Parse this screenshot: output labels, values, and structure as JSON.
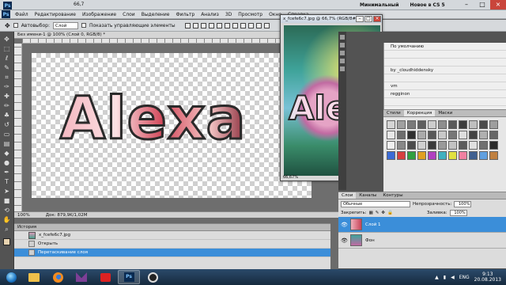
{
  "app": {
    "zoom_level": "66,7",
    "workspace_labels": [
      "Минимальный",
      "Новое в CS 5"
    ]
  },
  "menu": {
    "items": [
      "Файл",
      "Редактирование",
      "Изображение",
      "Слои",
      "Выделение",
      "Фильтр",
      "Анализ",
      "3D",
      "Просмотр",
      "Окно",
      "Справка"
    ]
  },
  "options": {
    "autoselect_label": "Автовыбор:",
    "autoselect_value": "Слой",
    "show_controls_label": "Показать управляющие элементы"
  },
  "document": {
    "tab_title": "Без имени-1 @ 100% (Слой 0, RGB/8) *",
    "canvas_text": "Alexa",
    "status_zoom": "100%",
    "status_doc": "Док: 879,9K/1,02M"
  },
  "float_window": {
    "title": "x_fcefe6c7.jpg @ 66,7% (RGB/8#)",
    "overlay_text": "Alex",
    "zoom": "66,67%"
  },
  "props_panel": {
    "rows": [
      "По умолчанию",
      "",
      "",
      "by _cloudhiddensky",
      "",
      "vm",
      "regginon",
      "",
      "",
      "",
      ""
    ]
  },
  "styles_panel": {
    "tabs": [
      "Стили",
      "Коррекция",
      "Маски"
    ],
    "colors": [
      "#d5d5d5",
      "#a0a0a0",
      "#7a7a7a",
      "#5f5f5f",
      "#cdcdcd",
      "#8e8e8e",
      "#5a5a5a",
      "#3d3d3d",
      "#bfbfbf",
      "#4a4a4a",
      "#9e9e9e",
      "#e8e8e8",
      "#6d6d6d",
      "#2f2f2f",
      "#aaaaaa",
      "#585858",
      "#c8c8c8",
      "#777777",
      "#dedede",
      "#434343",
      "#b0b0b0",
      "#666666",
      "#f0f0f0",
      "#888888",
      "#4c4c4c",
      "#d0d0d0",
      "#3a3a3a",
      "#9a9a9a",
      "#c2c2c2",
      "#5c5c5c",
      "#e0e0e0",
      "#707070",
      "#2a2a2a",
      "#3a6bd6",
      "#d64040",
      "#30a040",
      "#e0a020",
      "#b040c0",
      "#40b0c0",
      "#e0e040",
      "#f080a0",
      "#406090",
      "#60a0e0",
      "#c08040"
    ]
  },
  "layers": {
    "tabs": [
      "Слои",
      "Каналы",
      "Контуры"
    ],
    "blend_mode": "Обычные",
    "opacity_label": "Непрозрачность:",
    "opacity_value": "100%",
    "lock_label": "Закрепить:",
    "fill_label": "Заливка:",
    "fill_value": "100%",
    "rows": [
      {
        "name": "Слой 1",
        "active": true
      },
      {
        "name": "Фон",
        "active": false
      }
    ]
  },
  "history": {
    "tab": "История",
    "snapshot": "x_fcefe6c7.jpg",
    "steps": [
      "Открыть",
      "Перетаскивание слоя"
    ]
  },
  "taskbar": {
    "lang": "ENG",
    "time": "9:13",
    "date": "20.08.2013"
  }
}
